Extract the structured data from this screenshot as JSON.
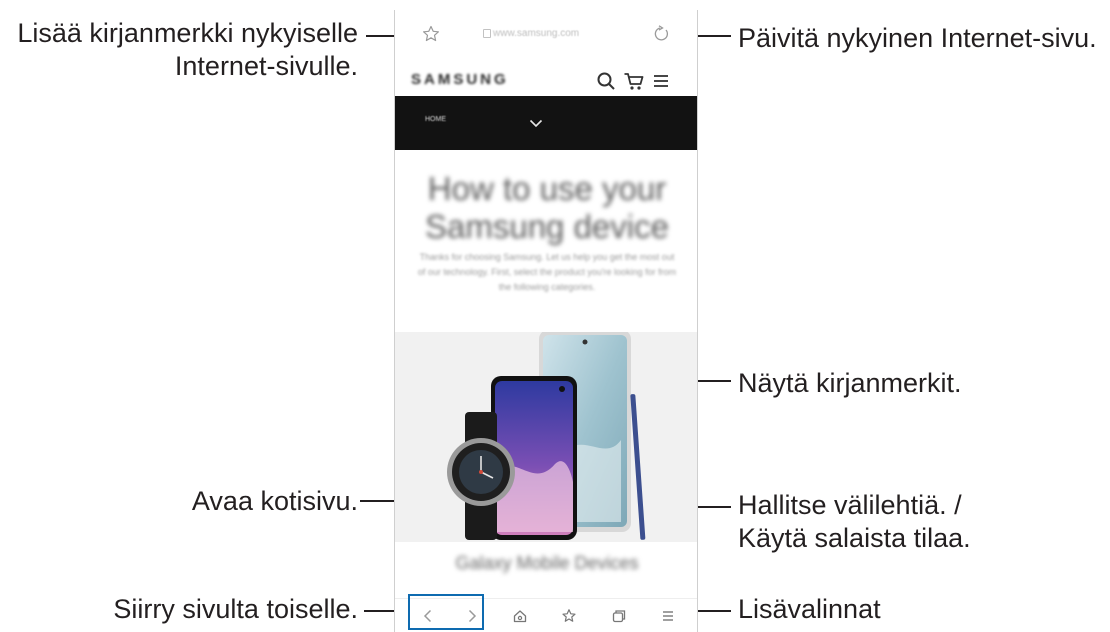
{
  "callouts": {
    "bookmark_add": [
      "Lisää kirjanmerkki nykyiselle",
      "Internet-sivulle."
    ],
    "refresh": "Päivitä nykyinen Internet-sivu.",
    "show_bookmarks": "Näytä kirjanmerkit.",
    "home": "Avaa kotisivu.",
    "tabs": [
      "Hallitse välilehtiä. /",
      "Käytä salaista tilaa."
    ],
    "navigate": "Siirry sivulta toiselle.",
    "more": "Lisävalinnat"
  },
  "browser": {
    "url": "www.samsung.com",
    "logo": "SAMSUNG",
    "nav_home": "HOME",
    "hero_title": "How to use your Samsung device",
    "hero_desc": "Thanks for choosing Samsung. Let us help you get the most out of our technology. First, select the product you're looking for from the following categories.",
    "bottom_heading": "Galaxy Mobile Devices"
  },
  "colors": {
    "accent_box": "#0e6bb0",
    "navbar": "#121212",
    "text": "#231f20"
  },
  "icons": {
    "bookmark_add": "star-outline-icon",
    "refresh": "refresh-icon",
    "search": "search-icon",
    "cart": "cart-icon",
    "menu": "hamburger-menu-icon",
    "back": "chevron-left-icon",
    "forward": "chevron-right-icon",
    "home": "home-icon",
    "bookmarks": "star-icon",
    "tabs": "tabs-icon",
    "more": "more-menu-icon"
  }
}
